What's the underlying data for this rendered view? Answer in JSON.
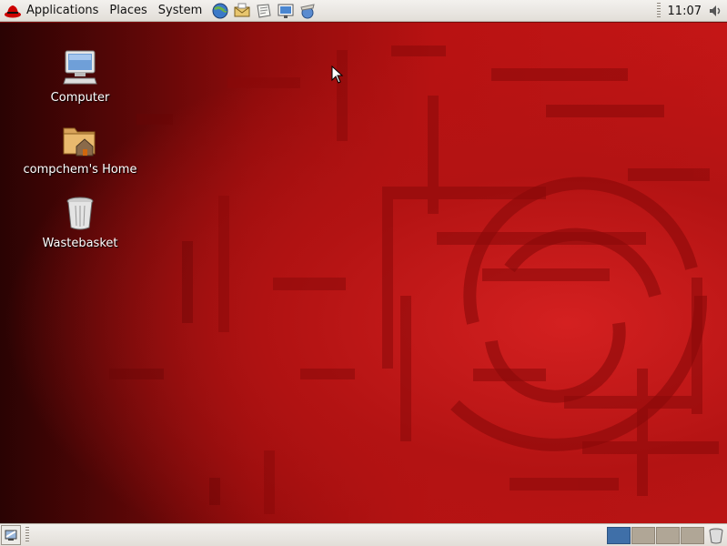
{
  "top_panel": {
    "menus": [
      {
        "label": "Applications",
        "icon": "redhat-icon"
      },
      {
        "label": "Places"
      },
      {
        "label": "System"
      }
    ],
    "launchers": [
      "web-browser-icon",
      "email-icon",
      "text-editor-icon",
      "presentation-icon",
      "network-icon"
    ],
    "clock": "11:07",
    "volume_icon": "volume-icon"
  },
  "desktop": {
    "icons": [
      {
        "label": "Computer",
        "icon": "computer-icon"
      },
      {
        "label": "compchem's Home",
        "icon": "home-folder-icon"
      },
      {
        "label": "Wastebasket",
        "icon": "wastebasket-icon"
      }
    ]
  },
  "bottom_panel": {
    "show_desktop_icon": "show-desktop-icon",
    "workspaces": [
      {
        "active": true
      },
      {
        "active": false
      },
      {
        "active": false
      },
      {
        "active": false
      }
    ],
    "trash_icon": "trash-applet-icon"
  },
  "colors": {
    "panel": "#e8e5e0",
    "desktop_red": "#b81212",
    "workspace_active": "#3f6fa8"
  }
}
